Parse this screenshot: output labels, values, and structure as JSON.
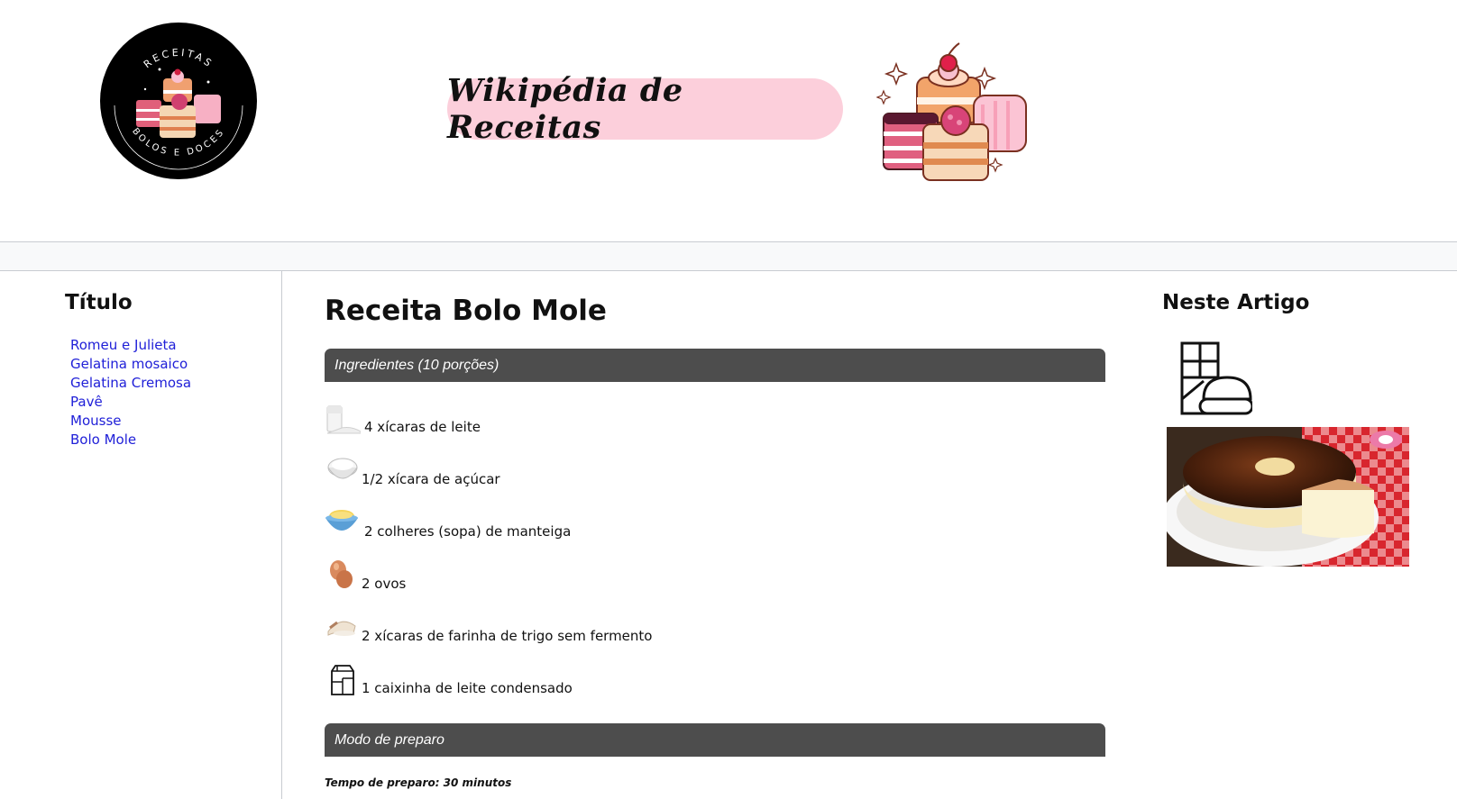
{
  "header": {
    "logo": {
      "top_text": "RECEITAS",
      "bottom_text": "BOLOS E DOCES",
      "icon": "cake-logo-icon"
    },
    "banner_text": "Wikipédia de Receitas",
    "illustration": "cakes-illustration-icon"
  },
  "sidebar": {
    "title": "Título",
    "links": [
      {
        "label": "Romeu e Julieta"
      },
      {
        "label": "Gelatina mosaico"
      },
      {
        "label": "Gelatina Cremosa"
      },
      {
        "label": "Pavê"
      },
      {
        "label": "Mousse"
      },
      {
        "label": "Bolo Mole"
      }
    ]
  },
  "main": {
    "title": "Receita Bolo Mole",
    "ingredients_header": "Ingredientes (10 porções)",
    "ingredients": [
      {
        "text": "4 xícaras de leite",
        "icon": "milk-icon"
      },
      {
        "text": "1/2 xícara de açúcar",
        "icon": "sugar-icon"
      },
      {
        "text": "2 colheres (sopa) de manteiga",
        "icon": "butter-icon"
      },
      {
        "text": "2 ovos",
        "icon": "eggs-icon"
      },
      {
        "text": "2 xícaras de farinha de trigo sem fermento",
        "icon": "flour-icon"
      },
      {
        "text": "1 caixinha de leite condensado",
        "icon": "milk-carton-icon"
      }
    ],
    "method_header": "Modo de preparo",
    "prep_time": "Tempo de preparo: 30 minutos"
  },
  "aside": {
    "title": "Neste Artigo",
    "icon": "cake-box-icon",
    "photo": "bolo-mole-photo"
  },
  "colors": {
    "banner_bg": "#fccfdb",
    "section_bar_bg": "#4d4d4d",
    "link": "#2020d8",
    "navbar_bg": "#f8f9fa"
  }
}
